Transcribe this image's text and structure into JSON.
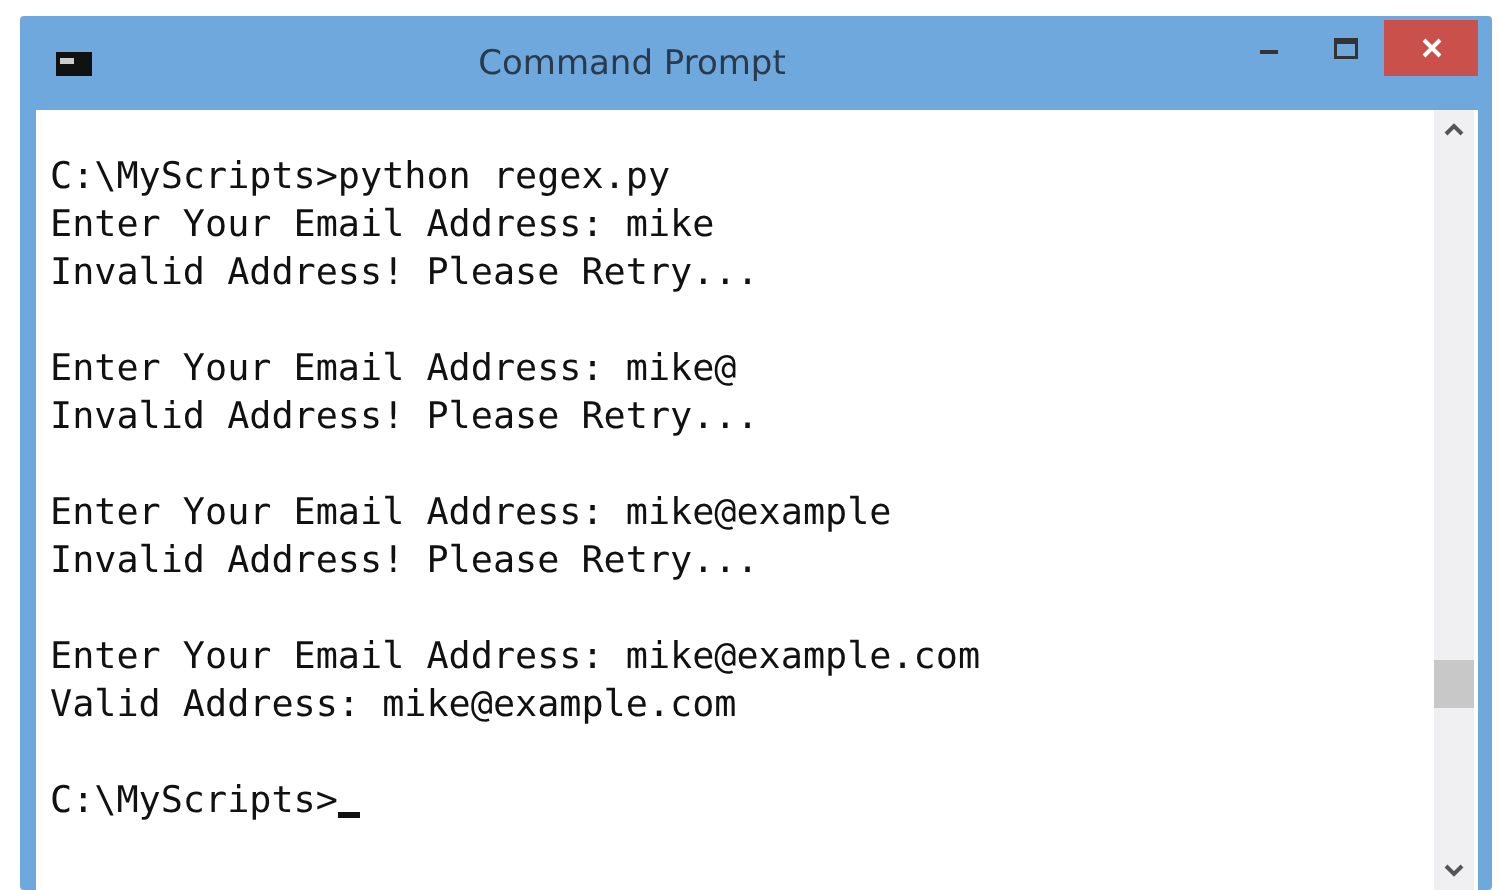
{
  "window": {
    "title": "Command Prompt"
  },
  "console": {
    "blocks": [
      [
        "C:\\MyScripts>python regex.py",
        "Enter Your Email Address: mike",
        "Invalid Address! Please Retry..."
      ],
      [
        "Enter Your Email Address: mike@",
        "Invalid Address! Please Retry..."
      ],
      [
        "Enter Your Email Address: mike@example",
        "Invalid Address! Please Retry..."
      ],
      [
        "Enter Your Email Address: mike@example.com",
        "Valid Address: mike@example.com"
      ]
    ],
    "prompt": "C:\\MyScripts>"
  }
}
